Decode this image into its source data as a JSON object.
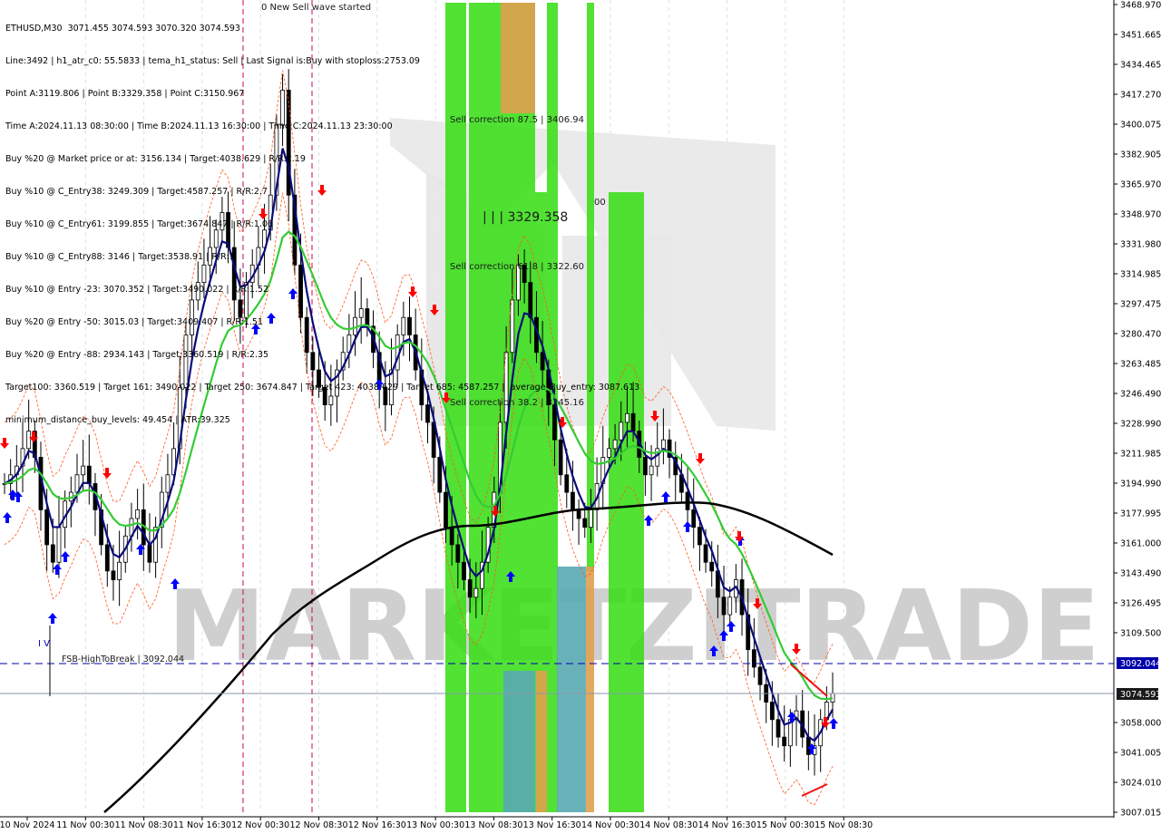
{
  "header": {
    "lines": [
      "ETHUSD,M30  3071.455 3074.593 3070.320 3074.593",
      "Line:3492 | h1_atr_c0: 55.5833 | tema_h1_status: Sell | Last Signal is:Buy with stoploss:2753.09",
      "Point A:3119.806 | Point B:3329.358 | Point C:3150.967",
      "Time A:2024.11.13 08:30:00 | Time B:2024.11.13 16:30:00 | Time C:2024.11.13 23:30:00",
      "Buy %20 @ Market price or at: 3156.134 | Target:4038.629 | R/R:2.19",
      "Buy %10 @ C_Entry38: 3249.309 | Target:4587.257 | R/R:2.7",
      "Buy %10 @ C_Entry61: 3199.855 | Target:3674.847 | R/R:1.06",
      "Buy %10 @ C_Entry88: 3146 | Target:3538.91 | R/R:1",
      "Buy %10 @ Entry -23: 3070.352 | Target:3490.022 | R/R:1.52",
      "Buy %20 @ Entry -50: 3015.03 | Target:3409.407 | R/R:1.51",
      "Buy %20 @ Entry -88: 2934.143 | Target:3360.519 | R/R:2.35",
      "Target100: 3360.519 | Target 161: 3490.022 | Target 250: 3674.847 | Target 423: 4038.629 | Target 685: 4587.257 |  average_Buy_entry: 3087.613",
      "minimum_distance_buy_levels: 49.454 | ATR:39.325"
    ]
  },
  "annotations": {
    "new_sell_wave": "0 New Sell wave started",
    "sell_corr_875": "Sell correction 87.5 | 3406.94",
    "sell_corr_618": "Sell correction 61.8 | 3322.60",
    "sell_corr_382": "Sell correction 38.2 | 3245.16",
    "point_b": "| | | 3329.358",
    "zero_mark": "00",
    "fsb": "FSB-HighToBreak | 3092.044",
    "iv_label": "I V",
    "watermark": "MARKETZITRADE"
  },
  "price_tags": {
    "fsb": "3092.044",
    "current": "3074.593"
  },
  "colors": {
    "candle": "#000000",
    "tema_blue": "#0a0a7a",
    "ma_green": "#33cc33",
    "ma_black": "#000000",
    "envelope": "#ff5a1f",
    "zone_green": "#33dd11",
    "zone_orange": "#e0a050",
    "zone_teal": "#5aaab3",
    "buy_arrow": "#0000ff",
    "sell_arrow": "#ff0000",
    "fsb_line": "#0000aa",
    "vline_magenta": "#cc0066"
  },
  "chart_data": {
    "type": "candlestick",
    "symbol": "ETHUSD",
    "timeframe": "M30",
    "ylim": [
      3000,
      3475
    ],
    "yticks": [
      "3468.970",
      "3451.665",
      "3434.465",
      "3417.270",
      "3400.075",
      "3382.905",
      "3365.970",
      "3348.970",
      "3331.980",
      "3314.985",
      "3297.475",
      "3280.470",
      "3263.485",
      "3246.490",
      "3228.990",
      "3211.985",
      "3194.990",
      "3177.995",
      "3161.000",
      "3143.490",
      "3126.495",
      "3109.500",
      "3092.044",
      "3074.593",
      "3058.000",
      "3041.005",
      "3024.010",
      "3007.015"
    ],
    "ytick_values": [
      3468.97,
      3451.665,
      3434.465,
      3417.27,
      3400.075,
      3382.905,
      3365.97,
      3348.97,
      3331.98,
      3314.985,
      3297.475,
      3280.47,
      3263.485,
      3246.49,
      3228.99,
      3211.985,
      3194.99,
      3177.995,
      3161.0,
      3143.49,
      3126.495,
      3109.5,
      null,
      null,
      3058.0,
      3041.005,
      3024.01,
      3007.015
    ],
    "xticks": [
      "10 Nov 2024",
      "11 Nov 00:30",
      "11 Nov 08:30",
      "11 Nov 16:30",
      "12 Nov 00:30",
      "12 Nov 08:30",
      "12 Nov 16:30",
      "13 Nov 00:30",
      "13 Nov 08:30",
      "13 Nov 16:30",
      "14 Nov 00:30",
      "14 Nov 08:30",
      "14 Nov 16:30",
      "15 Nov 00:30",
      "15 Nov 08:30"
    ],
    "levels": {
      "fsb_high_to_break": 3092.044,
      "current_price": 3074.593
    },
    "points": {
      "A": 3119.806,
      "B": 3329.358,
      "C": 3150.967
    },
    "close_series": [
      3195,
      3200,
      3205,
      3215,
      3225,
      3210,
      3180,
      3160,
      3150,
      3170,
      3185,
      3190,
      3200,
      3205,
      3195,
      3180,
      3160,
      3145,
      3140,
      3150,
      3165,
      3175,
      3180,
      3160,
      3150,
      3170,
      3190,
      3200,
      3215,
      3250,
      3280,
      3300,
      3310,
      3320,
      3330,
      3340,
      3350,
      3330,
      3300,
      3290,
      3310,
      3320,
      3330,
      3340,
      3360,
      3400,
      3420,
      3360,
      3320,
      3290,
      3270,
      3260,
      3250,
      3240,
      3245,
      3260,
      3270,
      3280,
      3290,
      3295,
      3285,
      3270,
      3250,
      3240,
      3260,
      3280,
      3290,
      3280,
      3260,
      3240,
      3230,
      3210,
      3190,
      3170,
      3160,
      3150,
      3140,
      3130,
      3135,
      3150,
      3170,
      3190,
      3230,
      3270,
      3300,
      3320,
      3310,
      3290,
      3270,
      3260,
      3240,
      3220,
      3200,
      3190,
      3180,
      3175,
      3170,
      3180,
      3195,
      3210,
      3215,
      3220,
      3230,
      3235,
      3225,
      3210,
      3200,
      3205,
      3215,
      3220,
      3210,
      3200,
      3190,
      3180,
      3170,
      3160,
      3150,
      3145,
      3130,
      3120,
      3130,
      3140,
      3120,
      3100,
      3090,
      3080,
      3070,
      3060,
      3050,
      3045,
      3060,
      3065,
      3050,
      3040,
      3045,
      3060,
      3070,
      3075
    ]
  }
}
